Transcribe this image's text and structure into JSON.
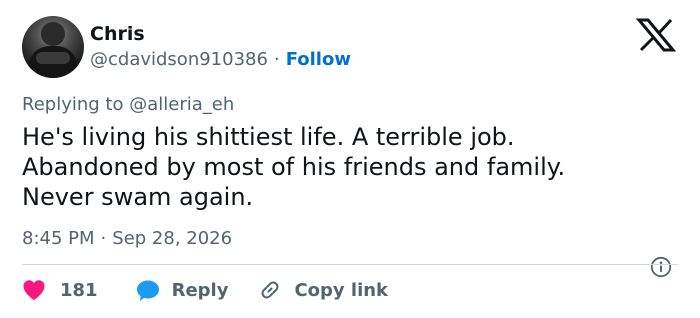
{
  "author": {
    "name": "Chris",
    "handle": "@cdavidson910386",
    "separator": "·",
    "follow_label": "Follow"
  },
  "replying": {
    "prefix": "Replying to",
    "mention": "@alleria_eh"
  },
  "tweet": {
    "lines": [
      "He's living his shittiest life. A terrible job.",
      "Abandoned by most of his friends and family.",
      "Never swam again."
    ]
  },
  "meta": {
    "time": "8:45 PM",
    "separator": "·",
    "date": "Sep 28, 2026"
  },
  "actions": {
    "like_count": "181",
    "reply_label": "Reply",
    "copy_label": "Copy link"
  },
  "icons": {
    "brand": "x-logo-icon",
    "like": "heart-icon",
    "reply": "speech-bubble-icon",
    "copy": "link-icon",
    "info": "info-icon"
  },
  "colors": {
    "text": "#0f1419",
    "secondary": "#536471",
    "follow": "#006fd6",
    "heart": "#f91880",
    "reply_bubble": "#1d9bf0",
    "divider": "#cfd9de"
  }
}
